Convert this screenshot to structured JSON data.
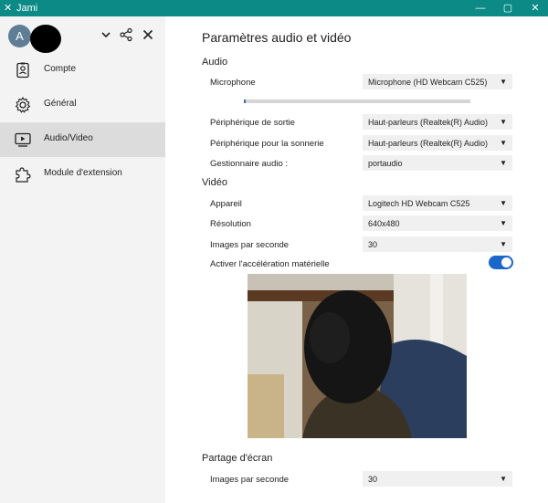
{
  "window": {
    "title": "Jami"
  },
  "account": {
    "avatar_letter": "A"
  },
  "sidebar": {
    "items": [
      {
        "label": "Compte",
        "icon": "account-icon",
        "active": false
      },
      {
        "label": "Général",
        "icon": "gear-icon",
        "active": false
      },
      {
        "label": "Audio/Video",
        "icon": "media-icon",
        "active": true
      },
      {
        "label": "Module d'extension",
        "icon": "puzzle-icon",
        "active": false
      }
    ]
  },
  "main": {
    "title": "Paramètres audio et vidéo",
    "audio": {
      "heading": "Audio",
      "microphone_label": "Microphone",
      "microphone_value": "Microphone (HD Webcam C525)",
      "mic_level": 0.01,
      "output_label": "Périphérique de sortie",
      "output_value": "Haut-parleurs (Realtek(R) Audio)",
      "ringtone_label": "Périphérique pour la sonnerie",
      "ringtone_value": "Haut-parleurs (Realtek(R) Audio)",
      "manager_label": "Gestionnaire audio :",
      "manager_value": "portaudio"
    },
    "video": {
      "heading": "Vidéo",
      "device_label": "Appareil",
      "device_value": "Logitech HD Webcam C525",
      "resolution_label": "Résolution",
      "resolution_value": "640x480",
      "fps_label": "Images par seconde",
      "fps_value": "30",
      "hwaccel_label": "Activer l'accélération matérielle",
      "hwaccel_enabled": true
    },
    "screenshare": {
      "heading": "Partage d'écran",
      "fps_label": "Images par seconde",
      "fps_value": "30"
    }
  },
  "colors": {
    "titlebar": "#0b8a86",
    "accent": "#1b66c9",
    "sidebar": "#f3f3f3",
    "active": "#dcdcdc"
  }
}
